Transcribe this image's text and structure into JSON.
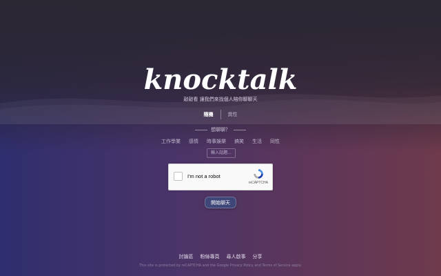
{
  "logo": {
    "text": "knocktalk"
  },
  "tagline": "敲敲看 讓我們來找個人陪你聊聊天",
  "mode_tabs": [
    {
      "label": "隨機",
      "active": true
    },
    {
      "label": "異性",
      "active": false
    }
  ],
  "topic_heading": "想聊聊？",
  "topics": [
    "工作學業",
    "感情",
    "時事娛樂",
    "搞笑",
    "生活",
    "同性"
  ],
  "custom_topic": {
    "placeholder": "輸入話題...",
    "value": ""
  },
  "recaptcha": {
    "checkbox_label": "I'm not a robot",
    "brand": "reCAPTCHA",
    "checked": false
  },
  "start_button": {
    "label": "開始聊天"
  },
  "footer": {
    "links": [
      "討論區",
      "粉絲專頁",
      "尋人啟事",
      "分享"
    ],
    "legal": "This site is protected by reCAPTCHA and the Google Privacy Policy and Terms of Service apply."
  },
  "colors": {
    "button_bg": "#3f4678",
    "bg_left": "#2f2e6e",
    "bg_right": "#6e3a4c",
    "bg_top": "#2b2733"
  }
}
